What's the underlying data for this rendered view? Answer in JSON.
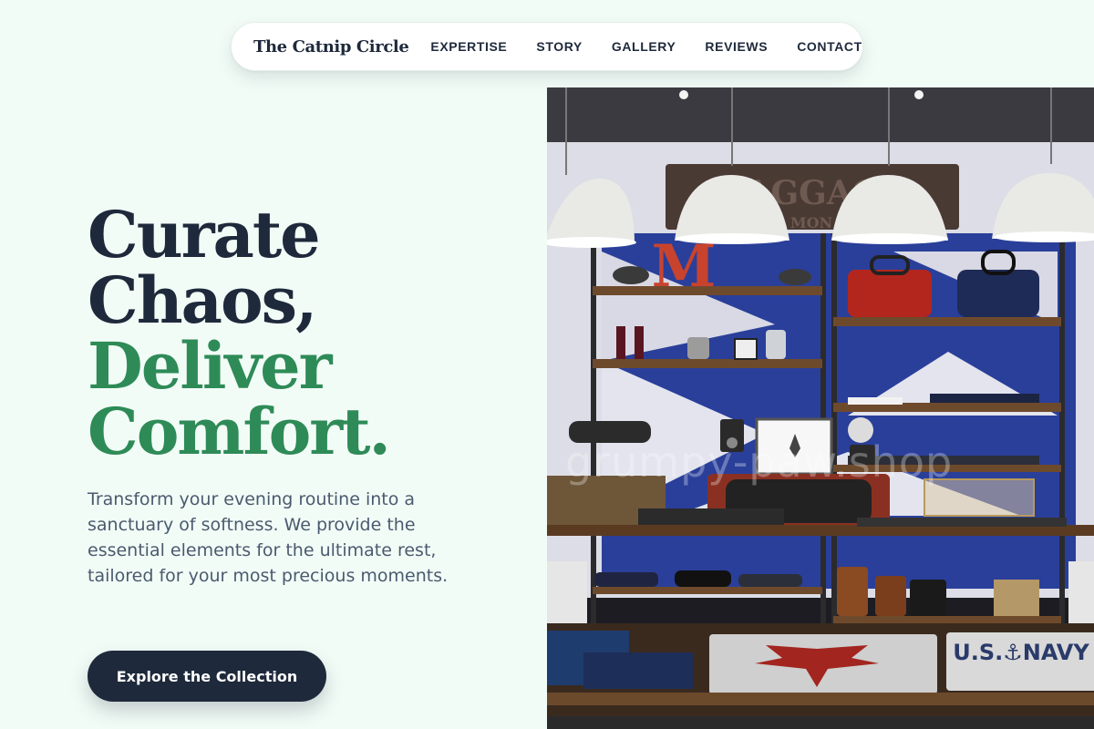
{
  "nav": {
    "brand": "The Catnip Circle",
    "links": [
      {
        "label": "EXPERTISE"
      },
      {
        "label": "STORY"
      },
      {
        "label": "GALLERY"
      },
      {
        "label": "REVIEWS"
      },
      {
        "label": "CONTACT"
      }
    ]
  },
  "hero": {
    "headline": {
      "line1": "Curate",
      "line2": "Chaos,",
      "line3": "Deliver",
      "line4": "Comfort."
    },
    "description": "Transform your evening routine into a sanctuary of softness. We provide the essential elements for the ultimate rest, tailored for your most precious moments.",
    "cta_label": "Explore the Collection"
  },
  "image": {
    "watermark": "grumpy-paw.shop",
    "sign_text": "BAGGAGE",
    "sign_subtext": "MON",
    "shelf_letter": "M",
    "tee_text": "U.S.⚓NAVY"
  },
  "colors": {
    "background": "#f2fcf7",
    "primary_dark": "#1e293b",
    "accent_green": "#2e8b57",
    "body_text": "#4a5a6e"
  }
}
